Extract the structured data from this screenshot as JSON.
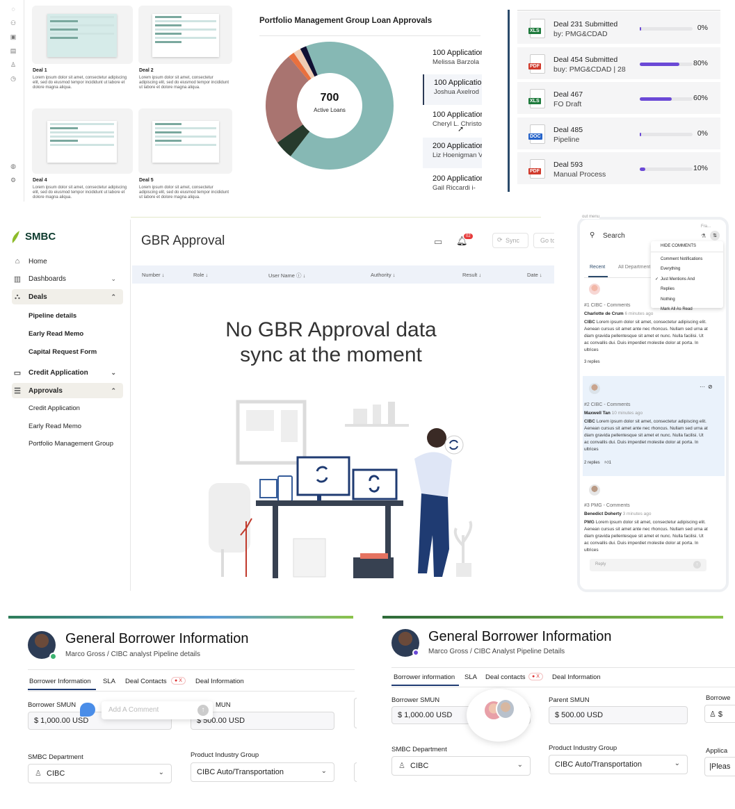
{
  "top_left": {
    "deals": [
      {
        "label": "Deal 1"
      },
      {
        "label": "Deal 2"
      },
      {
        "label": "Deal 4"
      },
      {
        "label": "Deal 5"
      }
    ],
    "snippet": "Lorem ipsum dolor sit amet, consectetur adipiscing elit, sed do eiusmod tempor incididunt ut labore et dolore magna aliqua."
  },
  "donut": {
    "title": "Portfolio Management Group Loan Approvals",
    "center_value": "700",
    "center_label": "Active Loans",
    "legend": [
      {
        "count": "100 Applications",
        "name": "Melissa Barzola"
      },
      {
        "count": "100 Applications",
        "name": "Joshua Axelrod"
      },
      {
        "count": "100 Applications",
        "name": "Cheryl L. Christo"
      },
      {
        "count": "200 Applications",
        "name": "Liz Hoenigman V"
      },
      {
        "count": "200 Applications",
        "name": "Gail Riccardi i-"
      }
    ]
  },
  "chart_data": {
    "type": "pie",
    "title": "Portfolio Management Group Loan Approvals",
    "slices": [
      {
        "value": 420,
        "color": "#86b8b4"
      },
      {
        "value": 30,
        "color": "#263a2c"
      },
      {
        "value": 150,
        "color": "#a97470"
      },
      {
        "value": 10,
        "color": "#e9703e"
      },
      {
        "value": 12,
        "color": "#f0cdb4"
      },
      {
        "value": 10,
        "color": "#101033"
      }
    ],
    "center_text": "700 Active Loans"
  },
  "deal_list": [
    {
      "file": "XLS",
      "color": "#1e7a3c",
      "title": "Deal 231 Submitted",
      "status": "by: PMG&CDAD",
      "progress": 0.03,
      "pct": "0%"
    },
    {
      "file": "PDF",
      "color": "#d0392b",
      "title": "Deal 454 Submitted",
      "status": "buy: PMG&CDAD | 28",
      "progress": 0.75,
      "pct": "80%"
    },
    {
      "file": "XLS",
      "color": "#1e7a3c",
      "title": "Deal 467",
      "status": "FO Draft",
      "progress": 0.6,
      "pct": "60%"
    },
    {
      "file": "DOC",
      "color": "#2563c9",
      "title": "Deal 485",
      "status": "Pipeline",
      "progress": 0.0,
      "pct": "0%"
    },
    {
      "file": "PDF",
      "color": "#d0392b",
      "title": "Deal 593",
      "status": "Manual Process",
      "progress": 0.1,
      "pct": "10%"
    }
  ],
  "sidebar": {
    "brand": "SMBC",
    "items": [
      {
        "label": "Home"
      },
      {
        "label": "Dashboards"
      },
      {
        "label": "Deals"
      },
      {
        "label": "Pipeline details"
      },
      {
        "label": "Early Read Memo"
      },
      {
        "label": "Capital Request Form"
      },
      {
        "label": "Credit Application"
      },
      {
        "label": "Approvals"
      },
      {
        "label": "Credit Application"
      },
      {
        "label": "Early Read Memo"
      },
      {
        "label": "Portfolio Management Group"
      }
    ]
  },
  "gbr": {
    "title": "GBR Approval",
    "badge": "02",
    "sync": "Sync",
    "goto": "Go to",
    "columns": [
      "Number",
      "Role",
      "User Name",
      "Authority",
      "Result",
      "Date"
    ],
    "empty_line1": "No GBR Approval data",
    "empty_line2": "sync at the moment"
  },
  "comments": {
    "header_cut": "out menu",
    "search_placeholder": "Search",
    "filter_cut": "Fra...",
    "tabs": [
      "Recent",
      "All Departments"
    ],
    "menu": [
      "Hide comments",
      "Comment Notifications",
      "Everything",
      "Just Mentions And",
      "Replies",
      "Nothing",
      "Mark All As Read"
    ],
    "threads": [
      {
        "head": "#1 CIBC - Comments",
        "author": "Charlotte de Crum",
        "time": "6 minutes ago",
        "org": "CIBC",
        "text": "Lorem ipsum dolor sit amet, consectetur adipiscing elit. Aenean cursus sit amet ante nec rhoncus. Nullam sed urna at diam gravida pellentesque sit amet et nunc. Nulla facilisi. Ut ac convallis dui. Duis imperdiet molestie dolor at porta. In ultrices",
        "replies": "3 replies"
      },
      {
        "head": "#2 CIBC - Comments",
        "author": "Maxwell Tan",
        "time": "10 minutes ago",
        "org": "CIBC",
        "text": "Lorem ipsum dolor sit amet, consectetur adipiscing elit. Aenean cursus sit amet ante nec rhoncus. Nullam sed urna at diam gravida pellentesque sit amet et nunc. Nulla facilisi. Ut ac convallis dui. Duis imperdiet molestie dolor at porta. In ultrices",
        "replies": "2 replies",
        "likes": "1"
      },
      {
        "head": "#3 PMG - Comments",
        "author": "Benedict Doherty",
        "time": "3 minutes ago",
        "org": "PMG",
        "text": "Lorem ipsum dolor sit amet, consectetur adipiscing elit. Aenean cursus sit amet ante nec rhoncus. Nullam sed urna at diam gravida pellentesque sit amet et nunc. Nulla facilisi. Ut ac convallis dui. Duis imperdiet molestie dolor at porta. In ultrices"
      }
    ],
    "reply_placeholder": "Reply"
  },
  "gbi_left": {
    "title": "General Borrower Information",
    "subtitle": "Marco Gross / CIBC analyst Pipeline details",
    "tabs": [
      "Borrower Information",
      "SLA",
      "Deal Contacts",
      "Deal Information"
    ],
    "tab_badge": "X",
    "field1_label": "Borrower SMUN",
    "field1_value": "$ 1,000.00 USD",
    "field2_label": "MUN",
    "field2_value": "$ 500.00 USD",
    "comment_placeholder": "Add A Comment",
    "dept_label": "SMBC Department",
    "dept_value": "CIBC",
    "pig_label": "Product Industry Group",
    "pig_value": "CIBC Auto/Transportation"
  },
  "gbi_right": {
    "title": "General Borrower Information",
    "subtitle": "Marco Gross / CIBC Analyst Pipeline Details",
    "tabs": [
      "Borrower information",
      "SLA",
      "Deal contacts",
      "Deal Information"
    ],
    "tab_badge": "X",
    "field1_label": "Borrower SMUN",
    "field1_value": "$ 1,000.00 USD",
    "field2_label": "Parent SMUN",
    "field2_value": "$ 500.00 USD",
    "field3_label": "Borrowe",
    "dept_label": "SMBC Department",
    "dept_value": "CIBC",
    "pig_label": "Product Industry Group",
    "pig_value": "CIBC Auto/Transportation",
    "app_label": "Applica",
    "app_value": "|Pleas"
  }
}
